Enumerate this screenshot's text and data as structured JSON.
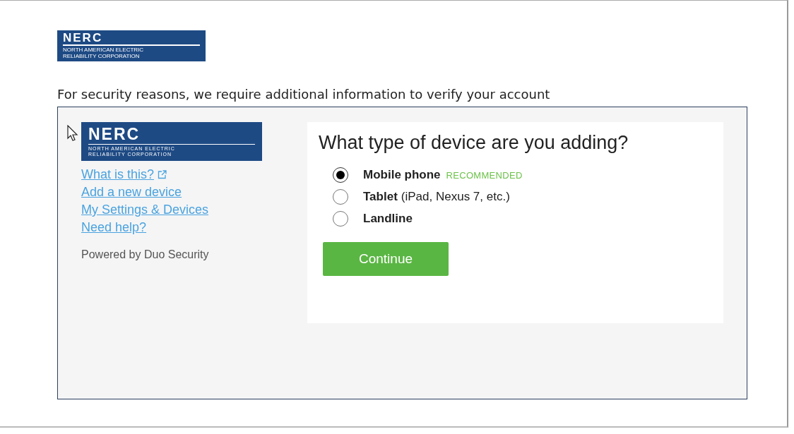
{
  "header_logo": {
    "name": "NERC",
    "line_1": "NORTH AMERICAN ELECTRIC",
    "line_2": "RELIABILITY CORPORATION"
  },
  "intro": "For security reasons, we require additional information to verify your account",
  "sidebar": {
    "logo": {
      "name": "NERC",
      "line_1": "NORTH AMERICAN ELECTRIC",
      "line_2": "RELIABILITY CORPORATION"
    },
    "links": [
      {
        "label": "What is this?",
        "external": true
      },
      {
        "label": "Add a new device",
        "external": false
      },
      {
        "label": "My Settings & Devices",
        "external": false
      },
      {
        "label": "Need help?",
        "external": false
      }
    ],
    "powered_by": "Powered by Duo Security"
  },
  "card": {
    "title": "What type of device are you adding?",
    "options": [
      {
        "label": "Mobile phone",
        "badge": "RECOMMENDED",
        "selected": true
      },
      {
        "label": "Tablet",
        "detail": "(iPad, Nexus 7, etc.)",
        "selected": false
      },
      {
        "label": "Landline",
        "selected": false
      }
    ],
    "button": "Continue"
  }
}
